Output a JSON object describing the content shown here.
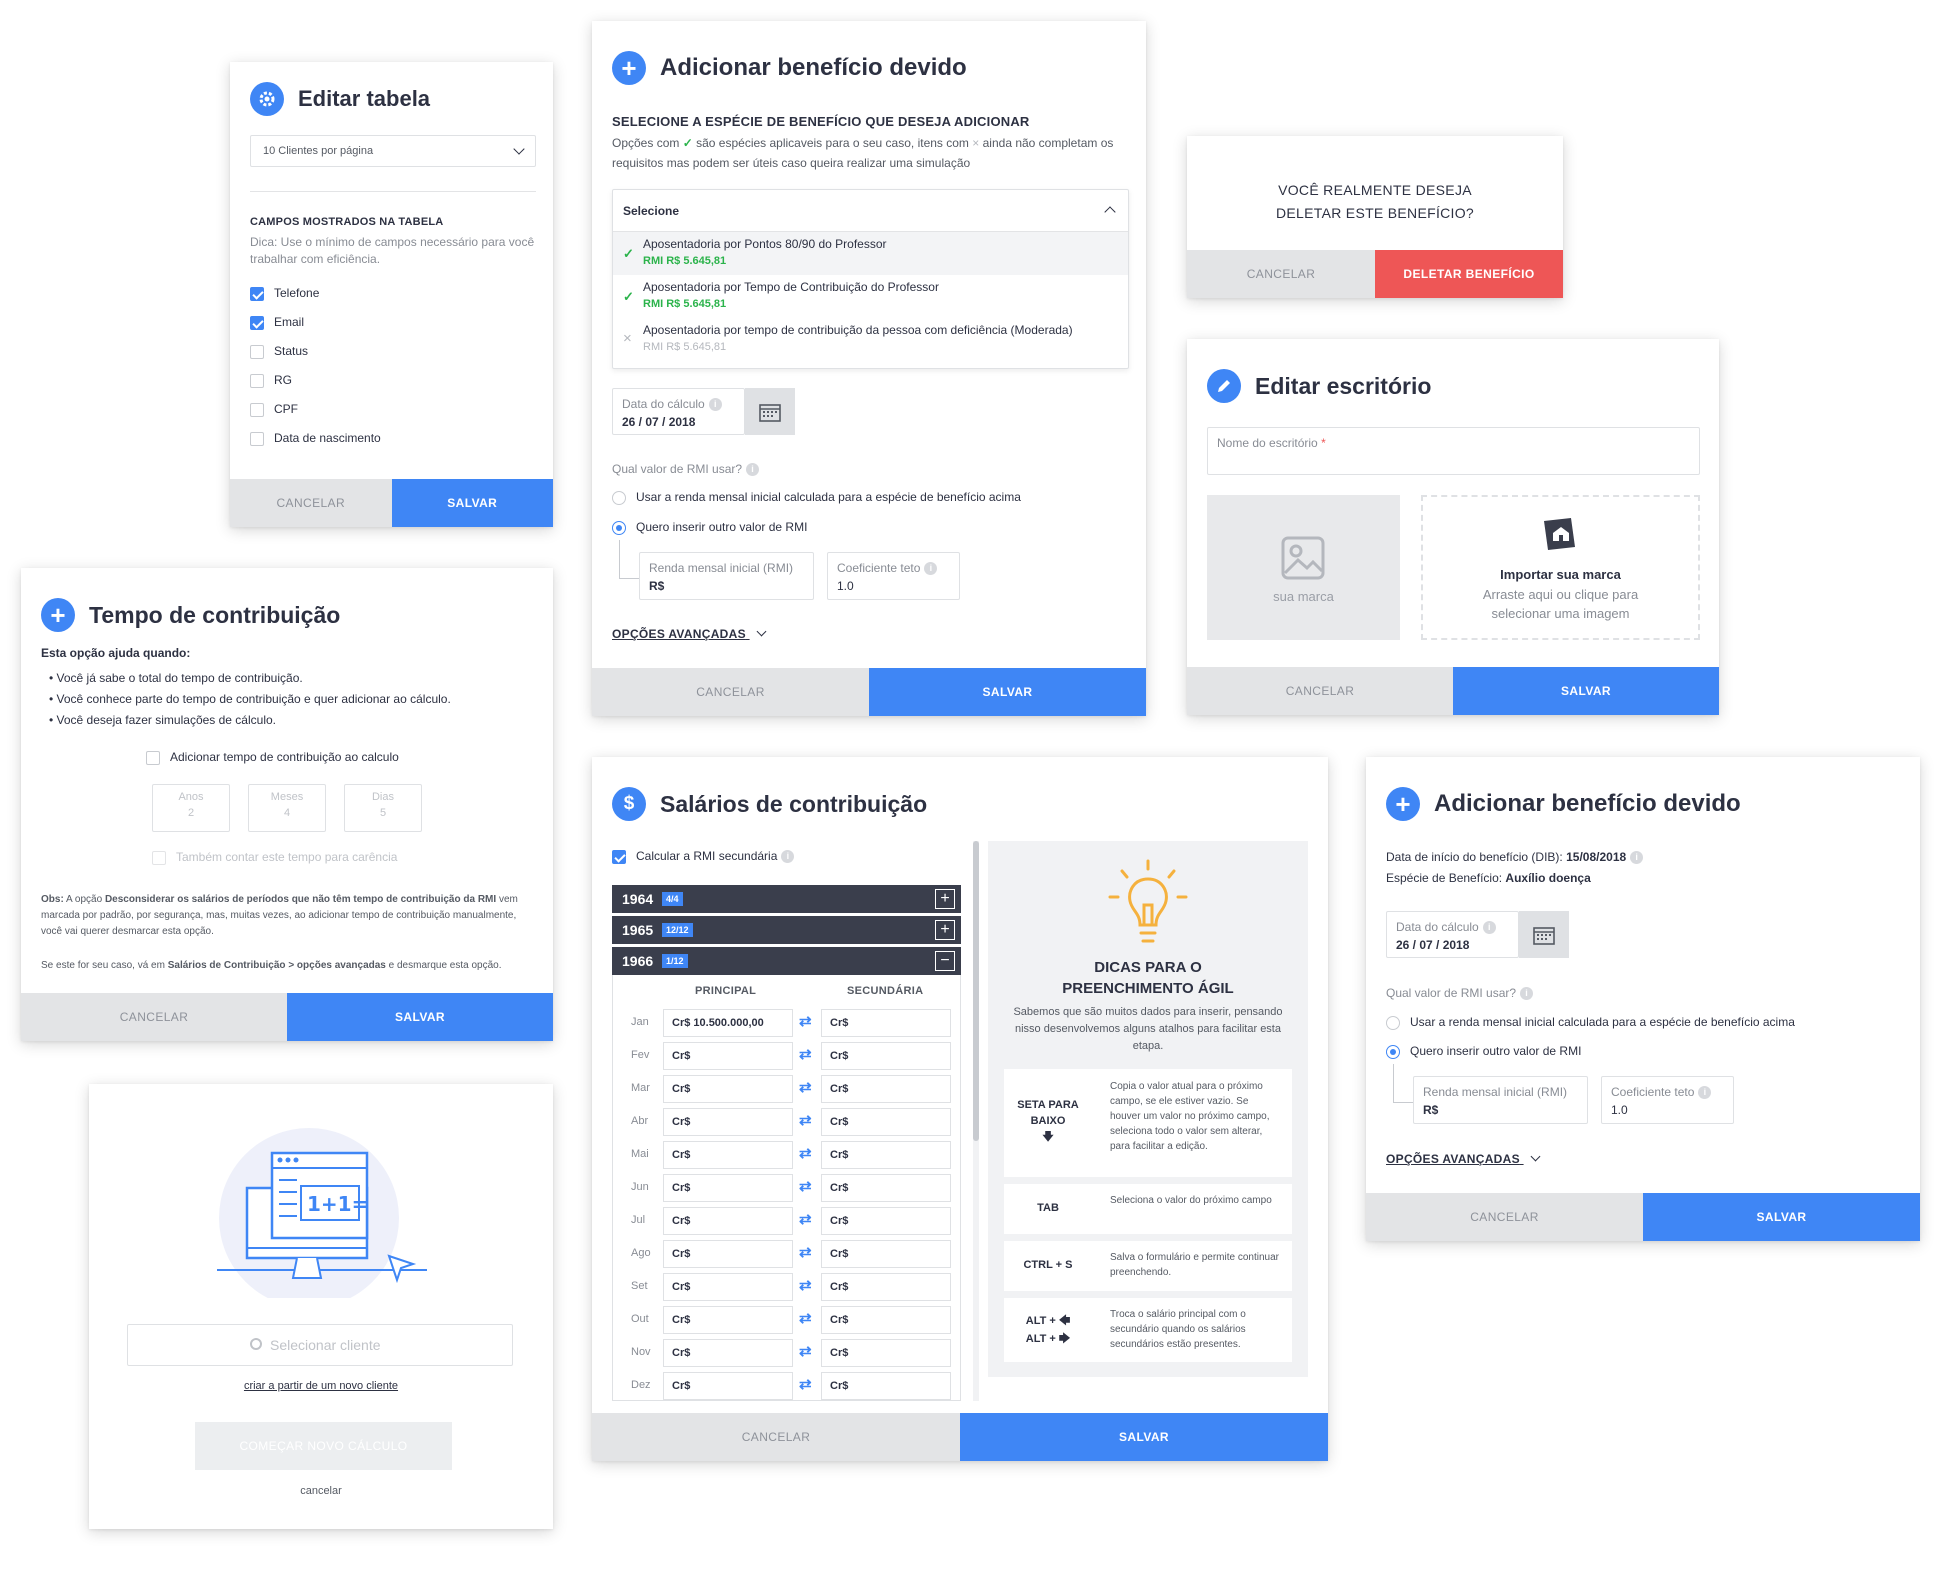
{
  "editar_tabela": {
    "title": "Editar tabela",
    "per_page": "10 Clientes por página",
    "section": "CAMPOS MOSTRADOS NA TABELA",
    "hint": "Dica: Use o mínimo de campos necessário para você trabalhar com eficiência.",
    "fields": [
      "Telefone",
      "Email",
      "Status",
      "RG",
      "CPF",
      "Data de nascimento"
    ],
    "cancel": "CANCELAR",
    "save": "SALVAR"
  },
  "adicionar1": {
    "title": "Adicionar benefício devido",
    "subtitle": "SELECIONE A ESPÉCIE DE BENEFÍCIO QUE DESEJA ADICIONAR",
    "desc_a": "Opções com",
    "desc_b": "são espécies aplicaveis para o seu caso, itens com",
    "desc_c": "ainda não completam os requisitos mas podem ser úteis caso queira realizar uma simulação",
    "select_label": "Selecione",
    "options": [
      {
        "name": "Aposentadoria por Pontos 80/90 do Professor",
        "rmi": "RMI R$ 5.645,81"
      },
      {
        "name": "Aposentadoria por Tempo de Contribuição do Professor",
        "rmi": "RMI R$ 5.645,81"
      },
      {
        "name": "Aposentadoria por tempo de contribuição da pessoa com deficiência (Moderada)",
        "rmi": "RMI R$ 5.645,81"
      }
    ],
    "date_label": "Data do cálculo",
    "date_value": "26 / 07 / 2018",
    "rmi_question": "Qual valor de RMI usar?",
    "radio1": "Usar a renda mensal inicial calculada para a espécie de benefício acima",
    "radio2": "Quero inserir outro valor de RMI",
    "rmi_label": "Renda mensal inicial (RMI)",
    "rmi_value": "R$",
    "coef_label": "Coeficiente teto",
    "coef_value": "1.0",
    "advanced": "OPÇÕES AVANÇADAS",
    "cancel": "CANCELAR",
    "save": "SALVAR"
  },
  "deletar": {
    "question": "VOCÊ REALMENTE DESEJA DELETAR ESTE BENEFÍCIO?",
    "cancel": "CANCELAR",
    "delete": "DELETAR BENEFÍCIO",
    "delete_color": "#ee5656"
  },
  "editar_escritorio": {
    "title": "Editar escritório",
    "name_label": "Nome do escritório",
    "required": "*",
    "logo_placeholder": "sua marca",
    "import_title": "Importar sua marca",
    "import_desc": "Arraste aqui ou clique para selecionar uma imagem",
    "cancel": "CANCELAR",
    "save": "SALVAR"
  },
  "tempo": {
    "title": "Tempo de contribuição",
    "intro": "Esta opção ajuda quando:",
    "bullets": [
      "• Você já sabe o total do tempo de contribuição.",
      "• Você conhece parte do tempo de contribuição e quer adicionar ao cálculo.",
      "• Você deseja fazer simulações de cálculo."
    ],
    "checkbox": "Adicionar tempo de contribuição ao calculo",
    "years_label": "Anos",
    "years": "2",
    "months_label": "Meses",
    "months": "4",
    "days_label": "Dias",
    "days": "5",
    "carencia": "Também contar este tempo para carência",
    "obs_pre": "Obs:",
    "obs_a": "A opção",
    "obs_b": "Desconsiderar os salários de períodos que não têm tempo de contribuição da RMI",
    "obs_c": "vem marcada por padrão, por segurança, mas, muitas vezes, ao adicionar tempo de contribuição manualmente, você vai querer desmarcar esta opção.",
    "final_a": "Se este for seu caso, vá em",
    "final_b": "Salários de Contribuição > opções avançadas",
    "final_c": "e desmarque esta opção.",
    "cancel": "CANCELAR",
    "save": "SALVAR"
  },
  "novo": {
    "search_placeholder": "Selecionar cliente",
    "link": "criar a partir de um novo cliente",
    "start": "COMEÇAR NOVO CÁLCULO",
    "cancel": "cancelar",
    "screen_text": "1+1="
  },
  "salarios": {
    "title": "Salários de contribuição",
    "title_icon": "$",
    "checkbox": "Calcular a RMI secundária",
    "years": [
      {
        "year": "1964",
        "badge": "4/4",
        "sign": "+"
      },
      {
        "year": "1965",
        "badge": "12/12",
        "sign": "+"
      },
      {
        "year": "1966",
        "badge": "1/12",
        "sign": "−"
      }
    ],
    "col_main": "PRINCIPAL",
    "col_sec": "SECUNDÁRIA",
    "months": [
      {
        "m": "Jan",
        "p": "Cr$ 10.500.000,00",
        "s": "Cr$"
      },
      {
        "m": "Fev",
        "p": "Cr$",
        "s": "Cr$"
      },
      {
        "m": "Mar",
        "p": "Cr$",
        "s": "Cr$"
      },
      {
        "m": "Abr",
        "p": "Cr$",
        "s": "Cr$"
      },
      {
        "m": "Mai",
        "p": "Cr$",
        "s": "Cr$"
      },
      {
        "m": "Jun",
        "p": "Cr$",
        "s": "Cr$"
      },
      {
        "m": "Jul",
        "p": "Cr$",
        "s": "Cr$"
      },
      {
        "m": "Ago",
        "p": "Cr$",
        "s": "Cr$"
      },
      {
        "m": "Set",
        "p": "Cr$",
        "s": "Cr$"
      },
      {
        "m": "Out",
        "p": "Cr$",
        "s": "Cr$"
      },
      {
        "m": "Nov",
        "p": "Cr$",
        "s": "Cr$"
      },
      {
        "m": "Dez",
        "p": "Cr$",
        "s": "Cr$"
      }
    ],
    "tips_title": "DICAS PARA O PREENCHIMENTO ÁGIL",
    "tips_desc": "Sabemos que são muitos dados para inserir, pensando nisso desenvolvemos alguns atalhos para facilitar esta etapa.",
    "tips": [
      {
        "key": "SETA PARA BAIXO",
        "desc": "Copia o valor atual para o próximo campo, se ele estiver vazio. Se houver um valor no próximo campo, seleciona todo o valor sem alterar, para facilitar a edição."
      },
      {
        "key": "TAB",
        "desc": "Seleciona o valor do próximo campo"
      },
      {
        "key": "CTRL + S",
        "desc": "Salva o formulário e permite continuar preenchendo."
      },
      {
        "key": "ALT + / ALT +",
        "desc": "Troca o salário principal com o secundário quando os salários secundários estão presentes."
      }
    ],
    "cancel": "CANCELAR",
    "save": "SALVAR"
  },
  "adicionar2": {
    "title": "Adicionar benefício devido",
    "dib_label": "Data de início do benefício (DIB):",
    "dib_value": "15/08/2018",
    "especie_label": "Espécie de Benefício:",
    "especie_value": "Auxílio doença",
    "date_label": "Data do cálculo",
    "date_value": "26 / 07 / 2018",
    "rmi_question": "Qual valor de RMI usar?",
    "radio1": "Usar a renda mensal inicial calculada para a espécie de benefício acima",
    "radio2": "Quero inserir outro valor de RMI",
    "rmi_label": "Renda mensal inicial (RMI)",
    "rmi_value": "R$",
    "coef_label": "Coeficiente teto",
    "coef_value": "1.0",
    "advanced": "OPÇÕES AVANÇADAS",
    "cancel": "CANCELAR",
    "save": "SALVAR"
  },
  "colors": {
    "primary": "#3f86f5",
    "dark_header": "#3a3e4c",
    "green": "#2bb34b",
    "danger": "#ee5656",
    "tip_bulb": "#f5b13d"
  }
}
